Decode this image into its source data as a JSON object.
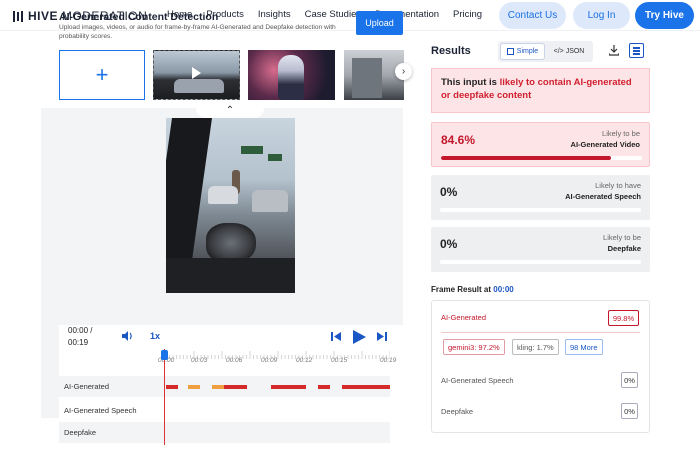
{
  "nav": {
    "logo_bold": "HIVE",
    "logo_rest": "MODERATION",
    "links": [
      "Home",
      "Products",
      "Insights",
      "Case Studies",
      "Documentation",
      "Pricing"
    ],
    "contact": "Contact Us",
    "login": "Log In",
    "try": "Try Hive"
  },
  "upload": {
    "title": "AI-Generated Content Detection",
    "description": "Upload images, videos, or audio for frame-by-frame AI-Generated and Deepfake detection with probability scores.",
    "button": "Upload"
  },
  "player": {
    "time_current": "00:00 /",
    "time_total": "00:19",
    "speed": "1x",
    "ticks": [
      "00:00",
      "00:03",
      "00:06",
      "00:09",
      "00:12",
      "00:15",
      "00:19"
    ],
    "rows": [
      "AI-Generated",
      "AI-Generated Speech",
      "Deepfake"
    ],
    "ai_segments": [
      {
        "start": 0.0,
        "end": 1.0,
        "color": "#d42a2a"
      },
      {
        "start": 1.9,
        "end": 2.9,
        "color": "#f0a040"
      },
      {
        "start": 3.9,
        "end": 4.9,
        "color": "#f0a040"
      },
      {
        "start": 4.9,
        "end": 6.9,
        "color": "#d42a2a"
      },
      {
        "start": 8.9,
        "end": 11.9,
        "color": "#d42a2a"
      },
      {
        "start": 12.9,
        "end": 13.9,
        "color": "#d42a2a"
      },
      {
        "start": 14.9,
        "end": 19.0,
        "color": "#d42a2a"
      }
    ],
    "duration_s": 19
  },
  "results": {
    "title": "Results",
    "tab_simple": "Simple",
    "tab_json": "</> JSON",
    "verdict_prefix": "This input is ",
    "verdict_highlight": "likely to contain AI-generated or deepfake content",
    "cards": [
      {
        "pct": "84.6%",
        "l1": "Likely to be",
        "l2": "AI-Generated Video",
        "fill": 0.846
      },
      {
        "pct": "0%",
        "l1": "Likely to have",
        "l2": "AI-Generated Speech",
        "fill": 0
      },
      {
        "pct": "0%",
        "l1": "Likely to be",
        "l2": "Deepfake",
        "fill": 0
      }
    ],
    "frame_label": "Frame Result at ",
    "frame_time": "00:00",
    "frame": {
      "ai_label": "AI-Generated",
      "ai_score": "99.8%",
      "sources": [
        "gemini3: 97.2%",
        "kling: 1.7%",
        "98 More"
      ],
      "speech_label": "AI-Generated Speech",
      "speech_score": "0%",
      "deepfake_label": "Deepfake",
      "deepfake_score": "0%"
    }
  },
  "colors": {
    "accent": "#1a73e8",
    "danger": "#c4172c"
  }
}
